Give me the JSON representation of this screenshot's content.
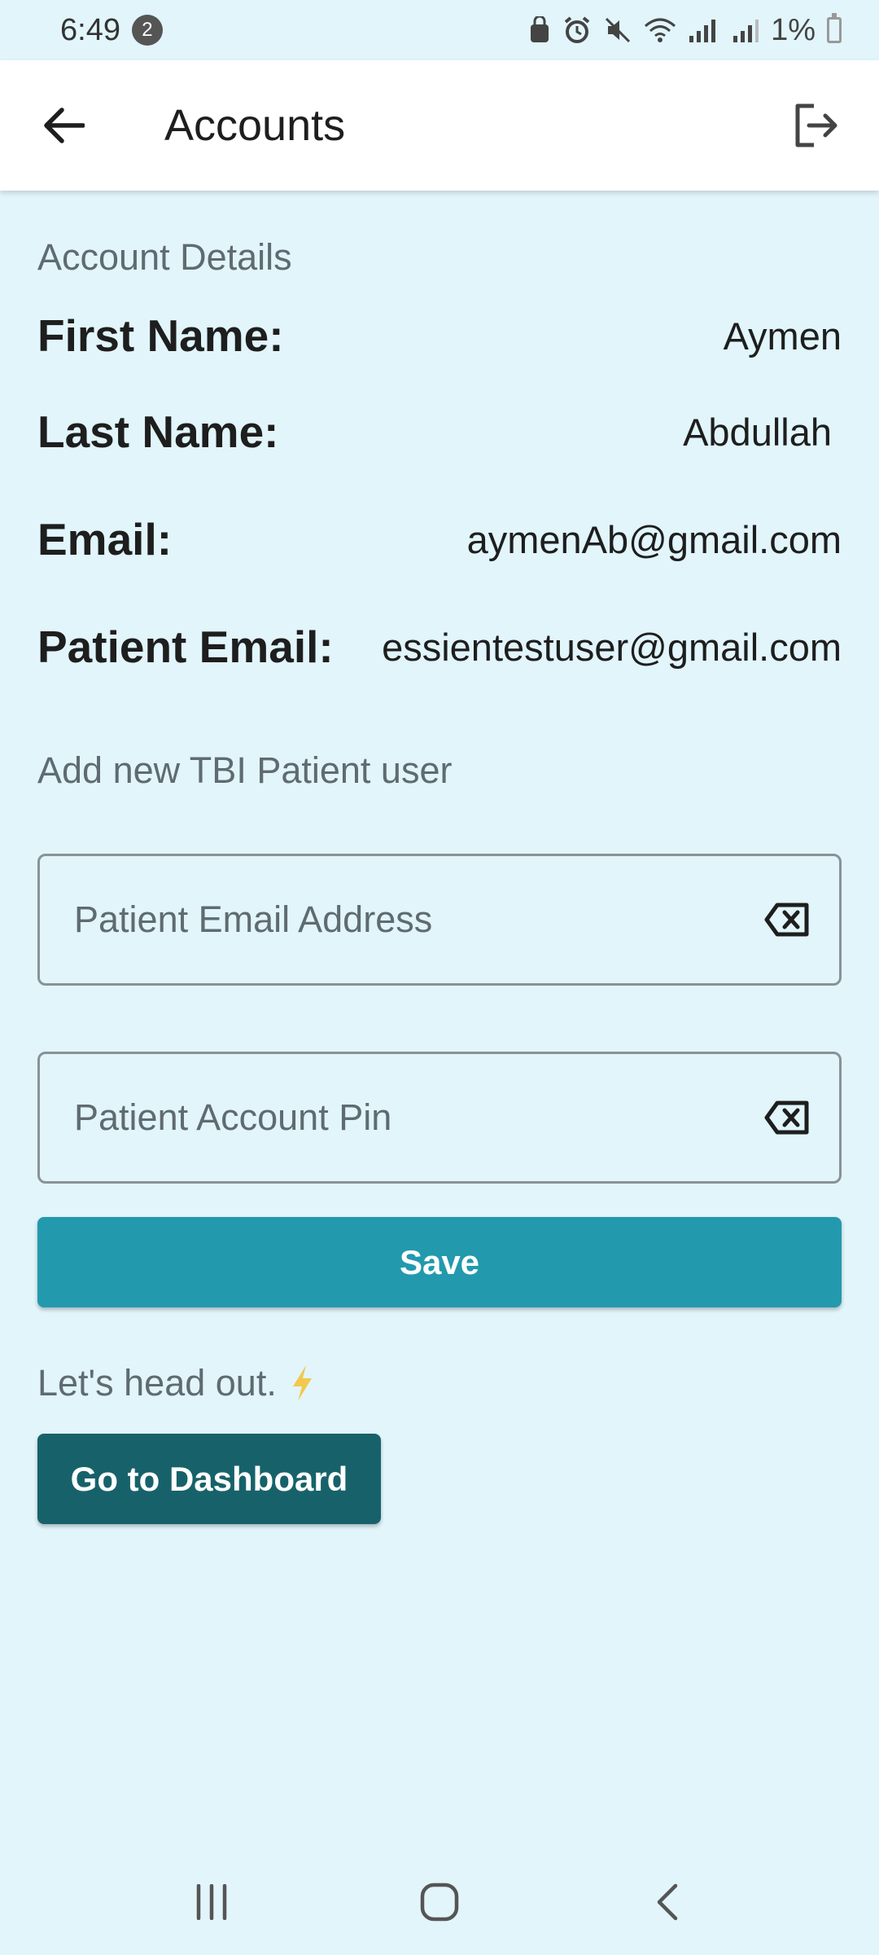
{
  "status_bar": {
    "time": "6:49",
    "notification_count": "2",
    "battery": "1%"
  },
  "app_bar": {
    "title": "Accounts",
    "back_icon": "arrow-left-icon",
    "logout_icon": "logout-icon"
  },
  "account_details": {
    "section_title": "Account Details",
    "fields": [
      {
        "label": "First Name:",
        "value": "Aymen"
      },
      {
        "label": "Last Name:",
        "value": "Abdullah"
      },
      {
        "label": "Email:",
        "value": "aymenAb@gmail.com"
      },
      {
        "label": "Patient Email:",
        "value": "essientestuser@gmail.com"
      }
    ]
  },
  "add_patient": {
    "section_title": "Add new TBI Patient user",
    "email_field": {
      "placeholder": "Patient Email Address",
      "value": ""
    },
    "pin_field": {
      "placeholder": "Patient Account Pin",
      "value": ""
    },
    "save_label": "Save"
  },
  "footer": {
    "head_out_text": "Let's head out.",
    "dashboard_label": "Go to Dashboard"
  },
  "colors": {
    "background": "#E1F5FB",
    "save_button": "#2399AD",
    "dashboard_button": "#17626A"
  }
}
